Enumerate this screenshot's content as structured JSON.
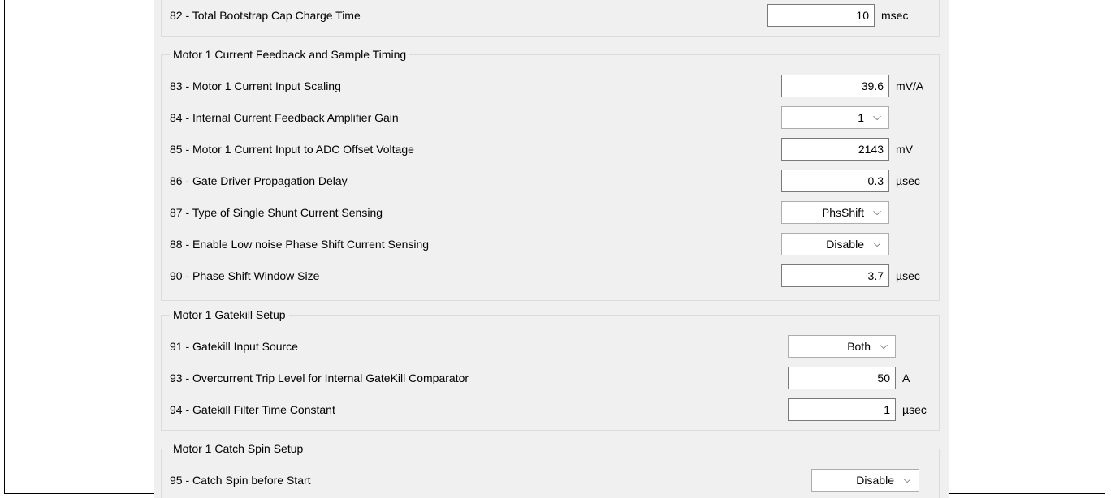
{
  "rows": {
    "r82": {
      "label": "82 - Total Bootstrap Cap Charge Time",
      "value": "10",
      "unit": "msec"
    },
    "r83": {
      "label": "83 - Motor 1 Current Input Scaling",
      "value": "39.6",
      "unit": "mV/A"
    },
    "r84": {
      "label": "84 - Internal Current Feedback Amplifier Gain",
      "value": "1"
    },
    "r85": {
      "label": "85 - Motor 1 Current Input to ADC Offset Voltage",
      "value": "2143",
      "unit": "mV"
    },
    "r86": {
      "label": "86 - Gate Driver Propagation Delay",
      "value": "0.3",
      "unit": "µsec"
    },
    "r87": {
      "label": "87 - Type of Single Shunt Current Sensing",
      "value": "PhsShift"
    },
    "r88": {
      "label": "88 - Enable Low noise Phase Shift Current Sensing",
      "value": "Disable"
    },
    "r90": {
      "label": "90 - Phase Shift Window Size",
      "value": "3.7",
      "unit": "µsec"
    },
    "r91": {
      "label": "91 - Gatekill Input Source",
      "value": "Both"
    },
    "r93": {
      "label": "93 - Overcurrent Trip Level for Internal GateKill Comparator",
      "value": "50",
      "unit": "A"
    },
    "r94": {
      "label": "94 - Gatekill Filter Time Constant",
      "value": "1",
      "unit": "µsec"
    },
    "r95": {
      "label": "95 - Catch Spin before Start",
      "value": "Disable"
    }
  },
  "groups": {
    "feedback": "Motor 1 Current Feedback and Sample Timing",
    "gatekill": "Motor 1 Gatekill Setup",
    "catchspin": "Motor 1 Catch Spin Setup"
  },
  "icons": {
    "dropdown": "chevron-down-icon"
  },
  "chevron_glyph": "⌵"
}
